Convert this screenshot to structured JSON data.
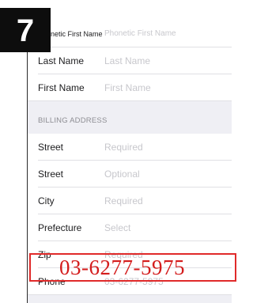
{
  "step_badge": "7",
  "form": {
    "rows_top": [
      {
        "label": "Phonetic First Name",
        "placeholder": "Phonetic First Name"
      },
      {
        "label": "Last Name",
        "placeholder": "Last Name"
      },
      {
        "label": "First Name",
        "placeholder": "First Name"
      }
    ],
    "billing_section": "BILLING ADDRESS",
    "billing_rows": [
      {
        "label": "Street",
        "placeholder": "Required"
      },
      {
        "label": "Street",
        "placeholder": "Optional"
      },
      {
        "label": "City",
        "placeholder": "Required"
      },
      {
        "label": "Prefecture",
        "placeholder": "Select"
      },
      {
        "label": "Zip",
        "placeholder": "Required"
      },
      {
        "label": "Phone",
        "placeholder": "03-6277-5975"
      }
    ]
  },
  "annotation": {
    "phone_overlay": "03-6277-5975",
    "highlight_color": "#e02a2a"
  }
}
